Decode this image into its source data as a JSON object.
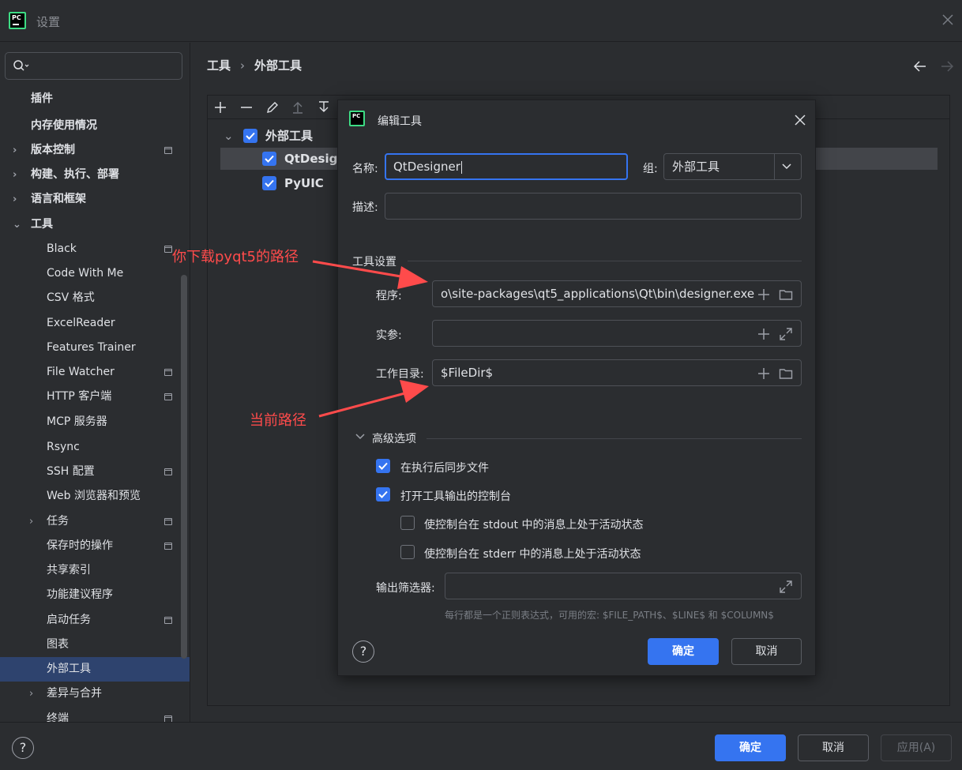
{
  "window": {
    "title": "设置",
    "logo_text": "PC"
  },
  "search": {
    "placeholder": ""
  },
  "sidebar": {
    "items": [
      {
        "label": "插件",
        "bold": true
      },
      {
        "label": "内存使用情况",
        "bold": true
      },
      {
        "label": "版本控制",
        "bold": true
      },
      {
        "label": "构建、执行、部署",
        "bold": true
      },
      {
        "label": "语言和框架",
        "bold": true
      },
      {
        "label": "工具",
        "bold": true
      },
      {
        "label": "Black"
      },
      {
        "label": "Code With Me"
      },
      {
        "label": "CSV 格式"
      },
      {
        "label": "ExcelReader"
      },
      {
        "label": "Features Trainer"
      },
      {
        "label": "File Watcher"
      },
      {
        "label": "HTTP 客户端"
      },
      {
        "label": "MCP 服务器"
      },
      {
        "label": "Rsync"
      },
      {
        "label": "SSH 配置"
      },
      {
        "label": "Web 浏览器和预览"
      },
      {
        "label": "任务"
      },
      {
        "label": "保存时的操作"
      },
      {
        "label": "共享索引"
      },
      {
        "label": "功能建议程序"
      },
      {
        "label": "启动任务"
      },
      {
        "label": "图表"
      },
      {
        "label": "外部工具",
        "selected": true
      },
      {
        "label": "差异与合并"
      },
      {
        "label": "终端"
      }
    ]
  },
  "breadcrumb": {
    "parent": "工具",
    "separator": "›",
    "current": "外部工具"
  },
  "tree": {
    "group": {
      "label": "外部工具",
      "checked": true
    },
    "items": [
      {
        "label": "QtDesigner",
        "checked": true,
        "selected": true
      },
      {
        "label": "PyUIC",
        "checked": true
      }
    ]
  },
  "dialog": {
    "title": "编辑工具",
    "logo_text": "PC",
    "name_label": "名称:",
    "name_value": "QtDesigner",
    "group_label": "组:",
    "group_value": "外部工具",
    "desc_label": "描述:",
    "desc_value": "",
    "tool_settings_label": "工具设置",
    "program_label": "程序:",
    "program_value": "o\\site-packages\\qt5_applications\\Qt\\bin\\designer.exe",
    "args_label": "实参:",
    "args_value": "",
    "workdir_label": "工作目录:",
    "workdir_value": "$FileDir$",
    "advanced_label": "高级选项",
    "options": [
      {
        "label": "在执行后同步文件",
        "checked": true
      },
      {
        "label": "打开工具输出的控制台",
        "checked": true
      },
      {
        "label": "使控制台在 stdout 中的消息上处于活动状态",
        "checked": false
      },
      {
        "label": "使控制台在 stderr 中的消息上处于活动状态",
        "checked": false
      }
    ],
    "output_filter_label": "输出筛选器:",
    "output_filter_value": "",
    "hint": "每行都是一个正则表达式，可用的宏: $FILE_PATH$、$LINE$ 和 $COLUMN$",
    "ok_label": "确定",
    "cancel_label": "取消",
    "help_glyph": "?"
  },
  "bottom": {
    "help_glyph": "?",
    "ok_label": "确定",
    "cancel_label": "取消",
    "apply_label": "应用(A)"
  },
  "annotations": {
    "download_path_note": "你下载pyqt5的路径",
    "current_path_note": "当前路径"
  },
  "colors": {
    "accent": "#3574f0",
    "annotation": "#ff4b4b",
    "background": "#2b2d30",
    "selected_nav": "#2e436e"
  }
}
